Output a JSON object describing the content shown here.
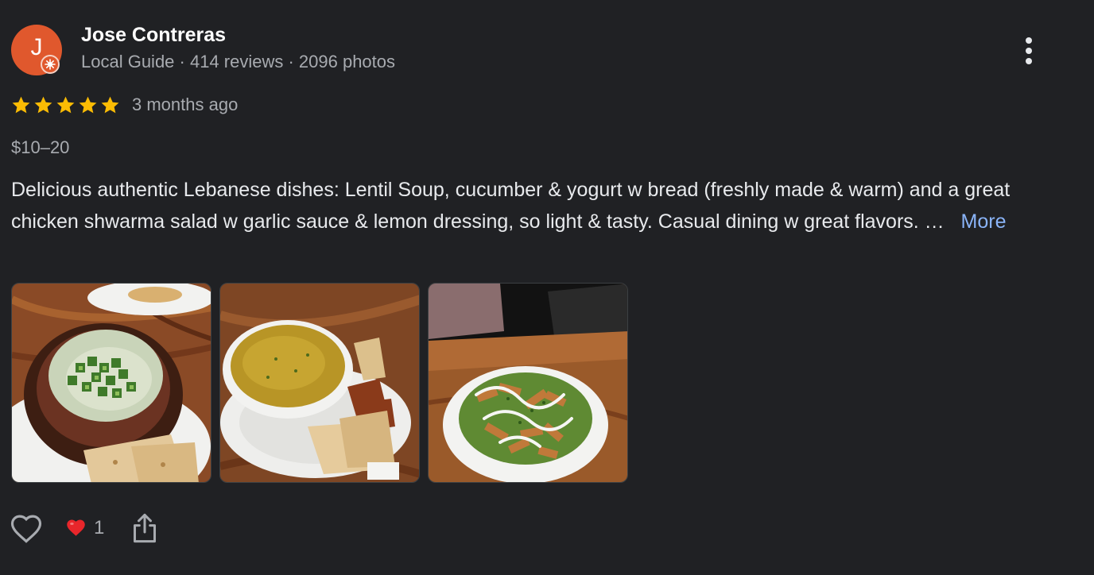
{
  "reviewer": {
    "initial": "J",
    "name": "Jose Contreras",
    "meta": "Local Guide · 414 reviews · 2096 photos"
  },
  "rating": {
    "stars": 5,
    "max": 5,
    "date": "3 months ago"
  },
  "price": "$10–20",
  "review": {
    "text": "Delicious authentic Lebanese dishes: Lentil Soup, cucumber & yogurt w bread (freshly made & warm) and a great chicken shwarma salad w garlic sauce & lemon dressing, so light & tasty. Casual dining w great flavors. …",
    "more_label": "More"
  },
  "photos": [
    {
      "name": "cucumber-yogurt-dip-photo"
    },
    {
      "name": "lentil-soup-photo"
    },
    {
      "name": "chicken-shawarma-salad-photo"
    }
  ],
  "actions": {
    "like_icon": "heart-outline-icon",
    "reaction_icon": "red-heart-icon",
    "reaction_count": "1",
    "share_icon": "share-icon"
  },
  "colors": {
    "background": "#202124",
    "avatar": "#e0582d",
    "star": "#fbbc04",
    "link": "#8ab4f8",
    "secondary_text": "#a8abb0"
  }
}
